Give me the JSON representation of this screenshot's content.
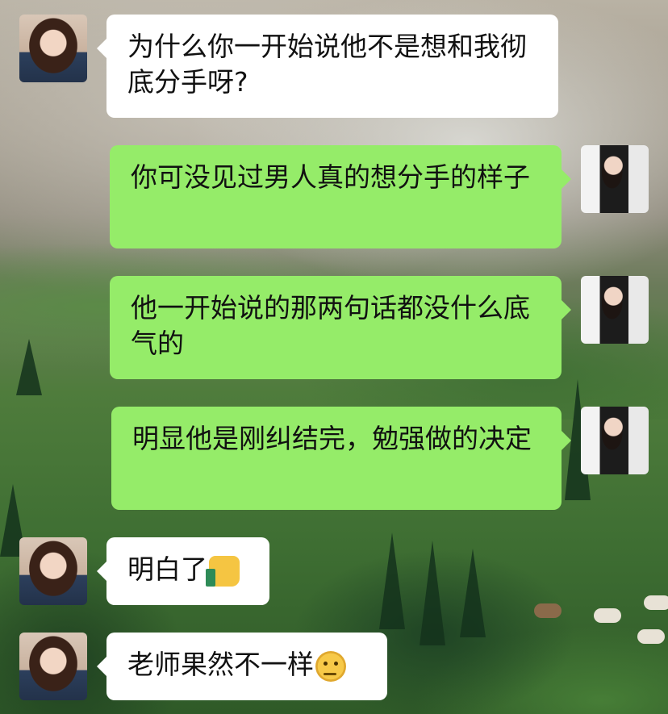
{
  "conversation": {
    "messages": [
      {
        "side": "left",
        "sender": "teacher",
        "text": "为什么你一开始说他不是想和我彻底分手呀?"
      },
      {
        "side": "right",
        "sender": "me",
        "text": "你可没见过男人真的想分手的样子"
      },
      {
        "side": "right",
        "sender": "me",
        "text": "他一开始说的那两句话都没什么底气的"
      },
      {
        "side": "right",
        "sender": "me",
        "text": "明显他是刚纠结完，勉强做的决定"
      },
      {
        "side": "left",
        "sender": "teacher",
        "text": "明白了",
        "emoji": "thumbs-up-icon"
      },
      {
        "side": "left",
        "sender": "teacher",
        "text": "老师果然不一样",
        "emoji": "thinking-face-icon"
      }
    ]
  },
  "colors": {
    "incoming_bubble": "#ffffff",
    "outgoing_bubble": "#95ec69",
    "text": "#111111"
  }
}
